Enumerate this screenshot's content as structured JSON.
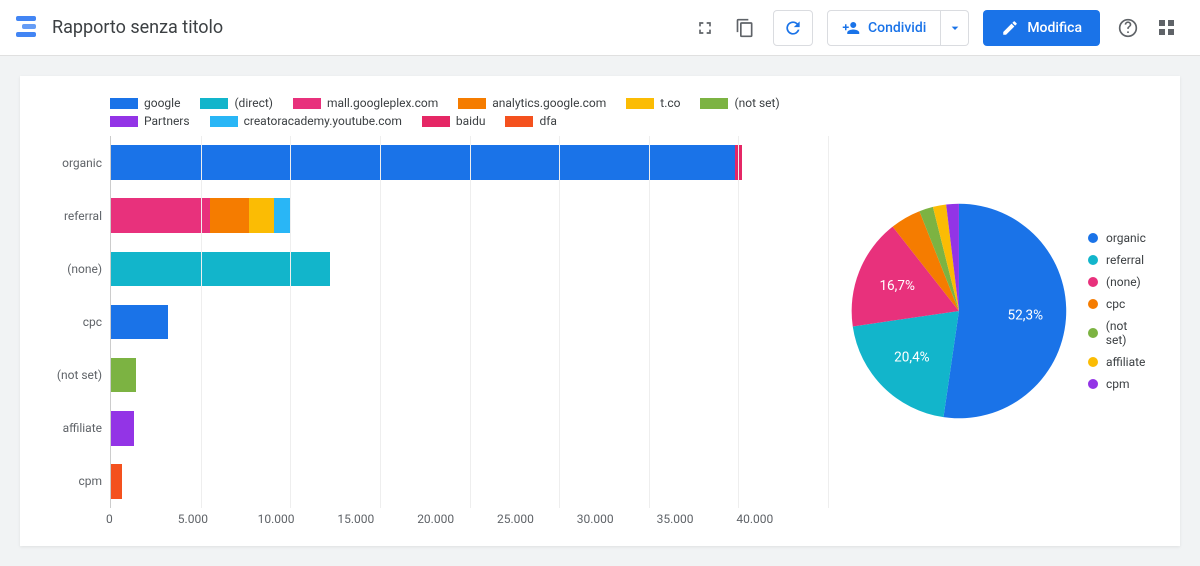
{
  "header": {
    "title": "Rapporto senza titolo",
    "share_label": "Condividi",
    "edit_label": "Modifica"
  },
  "chart_data": [
    {
      "type": "bar",
      "orientation": "horizontal",
      "stacked": true,
      "xlabel": "",
      "ylabel": "",
      "xlim": [
        0,
        40000
      ],
      "x_ticks": [
        "0",
        "5.000",
        "10.000",
        "15.000",
        "20.000",
        "25.000",
        "30.000",
        "35.000",
        "40.000"
      ],
      "categories": [
        "organic",
        "referral",
        "(none)",
        "cpc",
        "(not set)",
        "affiliate",
        "cpm"
      ],
      "series": [
        {
          "name": "google",
          "color": "#1a73e8",
          "values": [
            34800,
            0,
            0,
            3200,
            0,
            0,
            0
          ]
        },
        {
          "name": "(direct)",
          "color": "#12b5cb",
          "values": [
            0,
            0,
            12200,
            0,
            0,
            0,
            0
          ]
        },
        {
          "name": "mall.googleplex.com",
          "color": "#e8317c",
          "values": [
            0,
            5500,
            0,
            0,
            0,
            0,
            0
          ]
        },
        {
          "name": "analytics.google.com",
          "color": "#f57c00",
          "values": [
            0,
            2200,
            0,
            0,
            0,
            0,
            0
          ]
        },
        {
          "name": "t.co",
          "color": "#fbbc04",
          "values": [
            0,
            1400,
            0,
            0,
            0,
            0,
            0
          ]
        },
        {
          "name": "(not set)",
          "color": "#7cb342",
          "values": [
            0,
            0,
            0,
            0,
            1400,
            0,
            0
          ]
        },
        {
          "name": "Partners",
          "color": "#9334e6",
          "values": [
            0,
            0,
            0,
            0,
            0,
            1300,
            0
          ]
        },
        {
          "name": "creatoracademy.youtube.com",
          "color": "#29b6f6",
          "values": [
            0,
            900,
            0,
            0,
            0,
            0,
            0
          ]
        },
        {
          "name": "baidu",
          "color": "#e52765",
          "values": [
            400,
            0,
            0,
            0,
            0,
            0,
            0
          ]
        },
        {
          "name": "dfa",
          "color": "#f4511e",
          "values": [
            0,
            0,
            0,
            0,
            0,
            0,
            600
          ]
        }
      ]
    },
    {
      "type": "pie",
      "title": "",
      "series": [
        {
          "name": "organic",
          "value": 52.3,
          "color": "#1a73e8",
          "label": "52,3%"
        },
        {
          "name": "referral",
          "value": 20.4,
          "color": "#12b5cb",
          "label": "20,4%"
        },
        {
          "name": "(none)",
          "value": 16.7,
          "color": "#e8317c",
          "label": "16,7%"
        },
        {
          "name": "cpc",
          "value": 4.6,
          "color": "#f57c00",
          "label": ""
        },
        {
          "name": "(not set)",
          "value": 2.1,
          "color": "#7cb342",
          "label": ""
        },
        {
          "name": "affiliate",
          "value": 2.0,
          "color": "#fbbc04",
          "label": ""
        },
        {
          "name": "cpm",
          "value": 1.9,
          "color": "#9334e6",
          "label": ""
        }
      ]
    }
  ]
}
